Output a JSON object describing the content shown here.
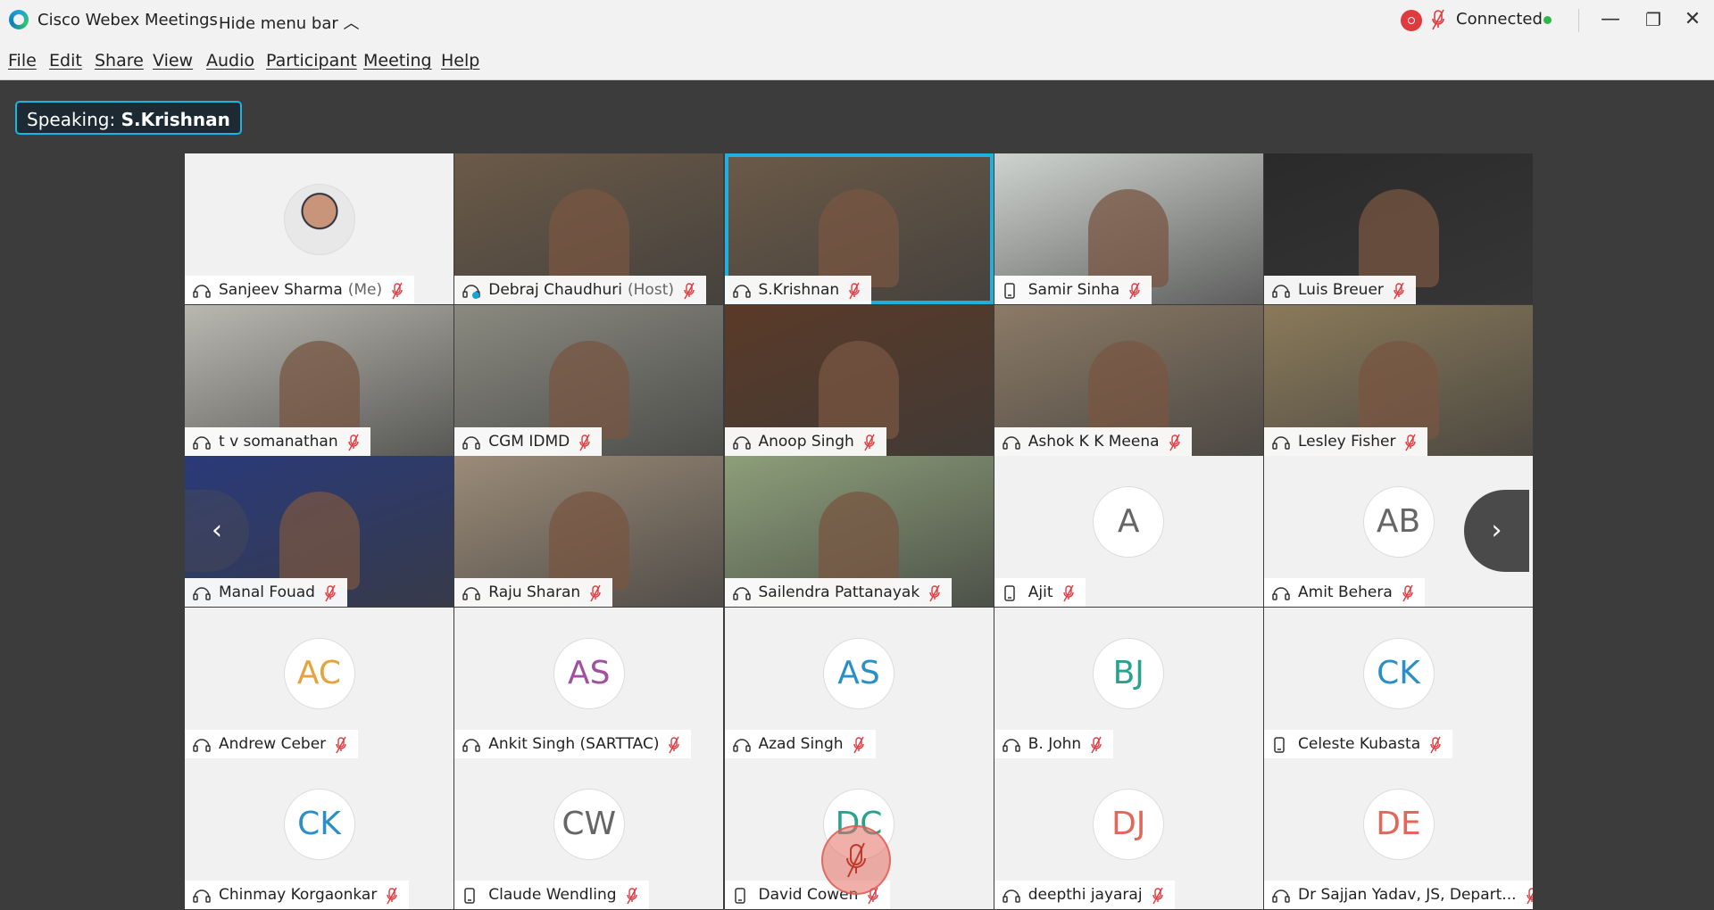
{
  "window": {
    "app_title": "Cisco Webex Meetings",
    "hide_menu_label": "Hide menu bar",
    "status_text": "Connected",
    "status_dot_color": "#2fb84a",
    "record_color": "#e0393e"
  },
  "menu": [
    "File",
    "Edit",
    "Share",
    "View",
    "Audio",
    "Participant",
    "Meeting",
    "Help"
  ],
  "speaking": {
    "prefix": "Speaking:",
    "name": "S.Krishnan"
  },
  "accent_color": "#1fb0e0",
  "tiles": [
    {
      "name": "Sanjeev Sharma",
      "role": "(Me)",
      "kind": "photo-avatar",
      "device": "headset-icon"
    },
    {
      "name": "Debraj Chaudhuri",
      "role": "(Host)",
      "kind": "video",
      "device": "host-headset-icon"
    },
    {
      "name": "S.Krishnan",
      "role": "",
      "kind": "video",
      "device": "headset-icon",
      "active": true
    },
    {
      "name": "Samir Sinha",
      "role": "",
      "kind": "video",
      "device": "phone-icon"
    },
    {
      "name": "Luis Breuer",
      "role": "",
      "kind": "video",
      "device": "headset-icon"
    },
    {
      "name": "t v somanathan",
      "role": "",
      "kind": "video",
      "device": "headset-icon"
    },
    {
      "name": "CGM IDMD",
      "role": "",
      "kind": "video",
      "device": "headset-icon"
    },
    {
      "name": "Anoop Singh",
      "role": "",
      "kind": "video",
      "device": "headset-icon"
    },
    {
      "name": "Ashok K K Meena",
      "role": "",
      "kind": "video",
      "device": "headset-icon"
    },
    {
      "name": "Lesley Fisher",
      "role": "",
      "kind": "video",
      "device": "headset-icon"
    },
    {
      "name": "Manal Fouad",
      "role": "",
      "kind": "video",
      "device": "headset-icon"
    },
    {
      "name": "Raju Sharan",
      "role": "",
      "kind": "video",
      "device": "headset-icon"
    },
    {
      "name": "Sailendra Pattanayak",
      "role": "",
      "kind": "video",
      "device": "headset-icon"
    },
    {
      "name": "Ajit",
      "role": "",
      "kind": "initials",
      "initials": "A",
      "color": "#666666",
      "device": "phone-icon"
    },
    {
      "name": "Amit Behera",
      "role": "",
      "kind": "initials",
      "initials": "AB",
      "color": "#666666",
      "device": "headset-icon"
    },
    {
      "name": "Andrew Ceber",
      "role": "",
      "kind": "initials",
      "initials": "AC",
      "color": "#e6a23c",
      "device": "headset-icon"
    },
    {
      "name": "Ankit Singh (SARTTAC)",
      "role": "",
      "kind": "initials",
      "initials": "AS",
      "color": "#a0509e",
      "device": "headset-icon"
    },
    {
      "name": "Azad Singh",
      "role": "",
      "kind": "initials",
      "initials": "AS",
      "color": "#2a8fc7",
      "device": "headset-icon"
    },
    {
      "name": "B. John",
      "role": "",
      "kind": "initials",
      "initials": "BJ",
      "color": "#2aa18e",
      "device": "headset-icon"
    },
    {
      "name": "Celeste Kubasta",
      "role": "",
      "kind": "initials",
      "initials": "CK",
      "color": "#2a8fc7",
      "device": "phone-icon"
    },
    {
      "name": "Chinmay Korgaonkar",
      "role": "",
      "kind": "initials",
      "initials": "CK",
      "color": "#2a8fc7",
      "device": "headset-icon"
    },
    {
      "name": "Claude Wendling",
      "role": "",
      "kind": "initials",
      "initials": "CW",
      "color": "#666666",
      "device": "phone-icon"
    },
    {
      "name": "David Cowen",
      "role": "",
      "kind": "initials",
      "initials": "DC",
      "color": "#2aa18e",
      "device": "phone-icon"
    },
    {
      "name": "deepthi jayaraj",
      "role": "",
      "kind": "initials",
      "initials": "DJ",
      "color": "#e0675a",
      "device": "headset-icon"
    },
    {
      "name": "Dr Sajjan Yadav, JS, Depart...",
      "role": "",
      "kind": "initials",
      "initials": "DE",
      "color": "#e0675a",
      "device": "headset-icon"
    }
  ],
  "video_colors": [
    "#6b5a48",
    "#6b5a48",
    "#cfd3cf",
    "#2a2a2a",
    "#b9b8b0",
    "#8a8a80",
    "#5a3a28",
    "#8b7a66",
    "#8a7a5a",
    "#2a3a7a",
    "#9b8b78",
    "#8d9f7a",
    "#7d8f6a"
  ],
  "nav": {
    "prev": "‹",
    "next": "›"
  }
}
